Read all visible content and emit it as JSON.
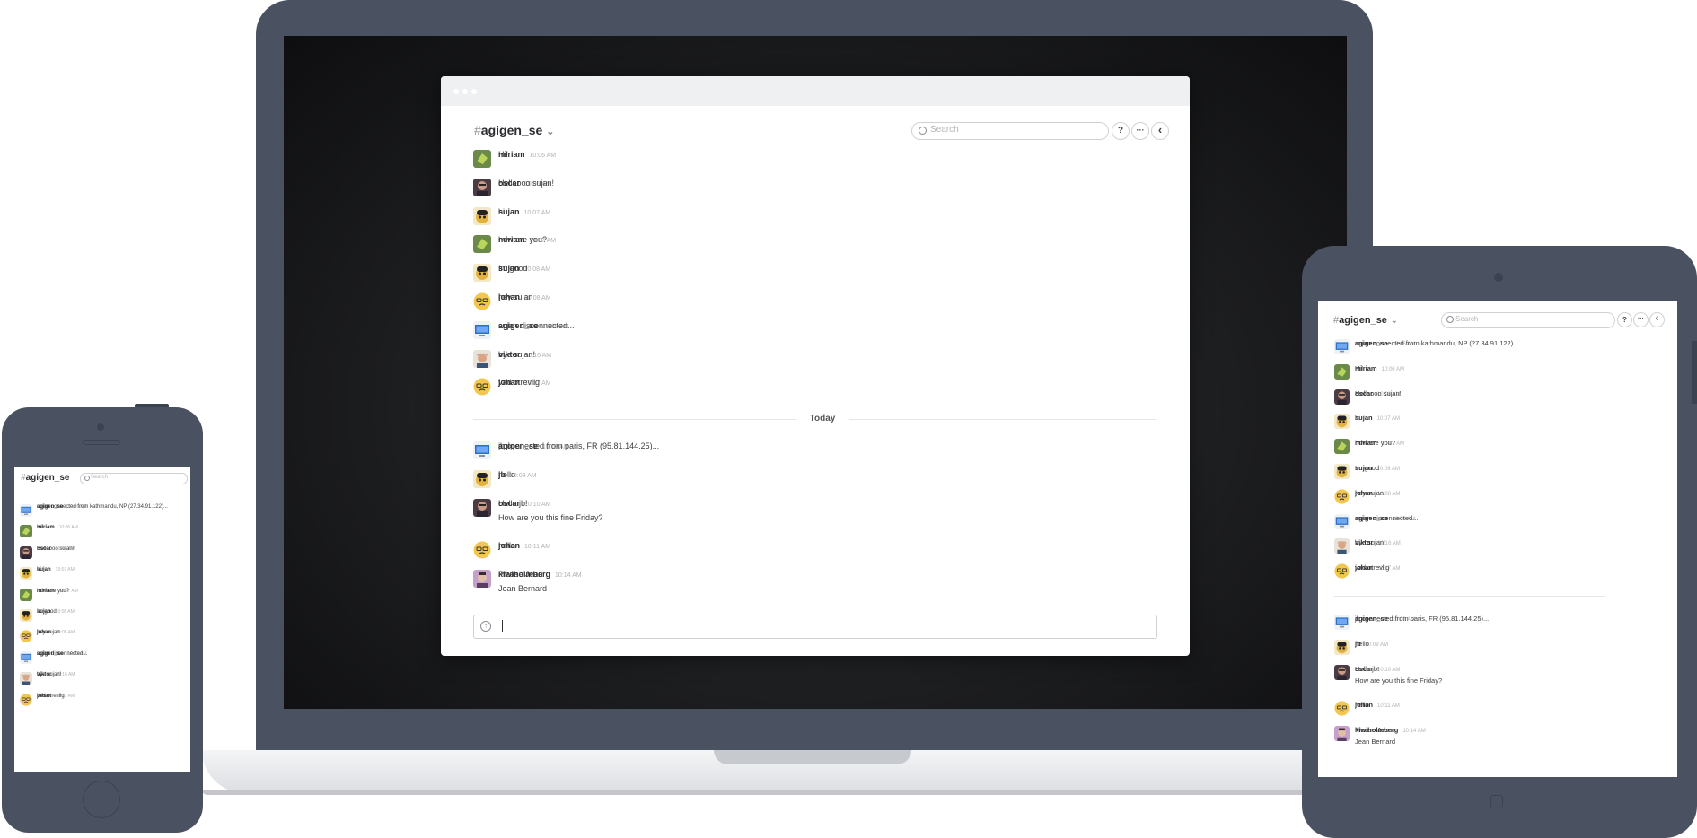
{
  "channel": {
    "hash": "#",
    "name": "agigen_se",
    "caret": "⌄"
  },
  "search": {
    "placeholder": "Search"
  },
  "header_buttons": {
    "help": "?",
    "more": "···",
    "back": "‹"
  },
  "day_divider": "Today",
  "desktop_messages": [
    {
      "user": "miriam",
      "time": "10:06 AM",
      "lines": [
        "Hi!"
      ],
      "avatar": "green-leaf-avatar"
    },
    {
      "user": "oscar",
      "time": "10:06 AM",
      "lines": [
        "Helloooo sujan!"
      ],
      "avatar": "oscar-photo-avatar"
    },
    {
      "user": "sujan",
      "time": "10:07 AM",
      "lines": [
        "hi"
      ],
      "avatar": "sujan-cartoon-avatar"
    },
    {
      "user": "miriam",
      "time": "10:07 AM",
      "lines": [
        "how are you?"
      ],
      "avatar": "green-leaf-avatar"
    },
    {
      "user": "sujan",
      "time": "10:08 AM",
      "lines": [
        "Im good"
      ],
      "avatar": "sujan-cartoon-avatar"
    },
    {
      "user": "johan",
      "time": "10:08 AM",
      "lines": [
        "hey sujan"
      ],
      "avatar": "smiley-glasses-avatar"
    },
    {
      "user": "agigen_se",
      "time": "10:09 AM",
      "lines": [
        "sujan disconnected..."
      ],
      "avatar": "computer-avatar"
    },
    {
      "user": "viktor",
      "time": "10:16 AM",
      "lines": [
        "bye sujan!"
      ],
      "avatar": "viktor-photo-avatar"
    },
    {
      "user": "johan",
      "time": "10:17 AM",
      "lines": [
        "vad otrevlig"
      ],
      "avatar": "smiley-glasses-avatar"
    }
  ],
  "desktop_today_messages": [
    {
      "user": "agigen_se",
      "time": "10:09 AM",
      "lines": [
        "jb connected from paris, FR (95.81.144.25)..."
      ],
      "avatar": "computer-avatar"
    },
    {
      "user": "jb",
      "time": "10:09 AM",
      "lines": [
        "hello"
      ],
      "avatar": "sujan-cartoon-avatar"
    },
    {
      "user": "oscar",
      "time": "10:10 AM",
      "lines": [
        "Hello jb!",
        "How are you this fine Friday?"
      ],
      "avatar": "oscar-photo-avatar"
    },
    {
      "user": "johan",
      "time": "10:11 AM",
      "lines": [
        "hello"
      ],
      "avatar": "smiley-glasses-avatar"
    },
    {
      "user": "kiwiholmberg",
      "time": "10:14 AM",
      "lines": [
        "Please Jean",
        "Jean Bernard"
      ],
      "avatar": "kiwi-photo-avatar"
    }
  ],
  "tablet_messages": [
    {
      "user": "agigen_se",
      "time": "10:06 AM",
      "lines": [
        "sujan connected from kathmandu, NP (27.34.91.122)..."
      ],
      "avatar": "computer-avatar"
    },
    {
      "user": "miriam",
      "time": "10:06 AM",
      "lines": [
        "Hi!"
      ],
      "avatar": "green-leaf-avatar"
    },
    {
      "user": "oscar",
      "time": "10:06 AM",
      "lines": [
        "Helloooo sujan!"
      ],
      "avatar": "oscar-photo-avatar"
    },
    {
      "user": "sujan",
      "time": "10:07 AM",
      "lines": [
        "hi"
      ],
      "avatar": "sujan-cartoon-avatar"
    },
    {
      "user": "miriam",
      "time": "10:07 AM",
      "lines": [
        "how are you?"
      ],
      "avatar": "green-leaf-avatar"
    },
    {
      "user": "sujan",
      "time": "10:08 AM",
      "lines": [
        "Im good"
      ],
      "avatar": "sujan-cartoon-avatar"
    },
    {
      "user": "johan",
      "time": "10:08 AM",
      "lines": [
        "hey sujan"
      ],
      "avatar": "smiley-glasses-avatar"
    },
    {
      "user": "agigen_se",
      "time": "10:09 AM",
      "lines": [
        "sujan disconnected..."
      ],
      "avatar": "computer-avatar"
    },
    {
      "user": "viktor",
      "time": "10:16 AM",
      "lines": [
        "bye sujan!"
      ],
      "avatar": "viktor-photo-avatar"
    },
    {
      "user": "johan",
      "time": "10:17 AM",
      "lines": [
        "vad otrevlig"
      ],
      "avatar": "smiley-glasses-avatar"
    }
  ],
  "tablet_today_messages": [
    {
      "user": "agigen_se",
      "time": "10:09 AM",
      "lines": [
        "jb connected from paris, FR (95.81.144.25)..."
      ],
      "avatar": "computer-avatar"
    },
    {
      "user": "jb",
      "time": "10:09 AM",
      "lines": [
        "hello"
      ],
      "avatar": "sujan-cartoon-avatar"
    },
    {
      "user": "oscar",
      "time": "10:10 AM",
      "lines": [
        "Hello jb!",
        "How are you this fine Friday?"
      ],
      "avatar": "oscar-photo-avatar"
    },
    {
      "user": "johan",
      "time": "10:11 AM",
      "lines": [
        "hello"
      ],
      "avatar": "smiley-glasses-avatar"
    },
    {
      "user": "kiwiholmberg",
      "time": "10:14 AM",
      "lines": [
        "Please Jean",
        "Jean Bernard"
      ],
      "avatar": "kiwi-photo-avatar"
    }
  ],
  "phone_messages": [
    {
      "user": "agigen_se",
      "time": "10:06 AM",
      "lines": [
        "sujan connected from kathmandu, NP (27.34.91.122)..."
      ],
      "avatar": "computer-avatar"
    },
    {
      "user": "miriam",
      "time": "10:06 AM",
      "lines": [
        "Hi!"
      ],
      "avatar": "green-leaf-avatar"
    },
    {
      "user": "oscar",
      "time": "10:06 AM",
      "lines": [
        "Helloooo sujan!"
      ],
      "avatar": "oscar-photo-avatar"
    },
    {
      "user": "sujan",
      "time": "10:07 AM",
      "lines": [
        "hi"
      ],
      "avatar": "sujan-cartoon-avatar"
    },
    {
      "user": "miriam",
      "time": "10:07 AM",
      "lines": [
        "how are you?"
      ],
      "avatar": "green-leaf-avatar"
    },
    {
      "user": "sujan",
      "time": "10:08 AM",
      "lines": [
        "Im good"
      ],
      "avatar": "sujan-cartoon-avatar"
    },
    {
      "user": "johan",
      "time": "10:08 AM",
      "lines": [
        "hey sujan"
      ],
      "avatar": "smiley-glasses-avatar"
    },
    {
      "user": "agigen_se",
      "time": "10:09 AM",
      "lines": [
        "sujan disconnected..."
      ],
      "avatar": "computer-avatar"
    },
    {
      "user": "viktor",
      "time": "10:16 AM",
      "lines": [
        "bye sujan!"
      ],
      "avatar": "viktor-photo-avatar"
    },
    {
      "user": "johan",
      "time": "10:17 AM",
      "lines": [
        "vad otrevlig"
      ],
      "avatar": "smiley-glasses-avatar"
    }
  ],
  "colors": {
    "device_frame": "#4a5261",
    "window_bg": "#ffffff",
    "titlebar": "#eef0f1",
    "text": "#2c2d30",
    "timestamp": "#b0b2b5"
  }
}
